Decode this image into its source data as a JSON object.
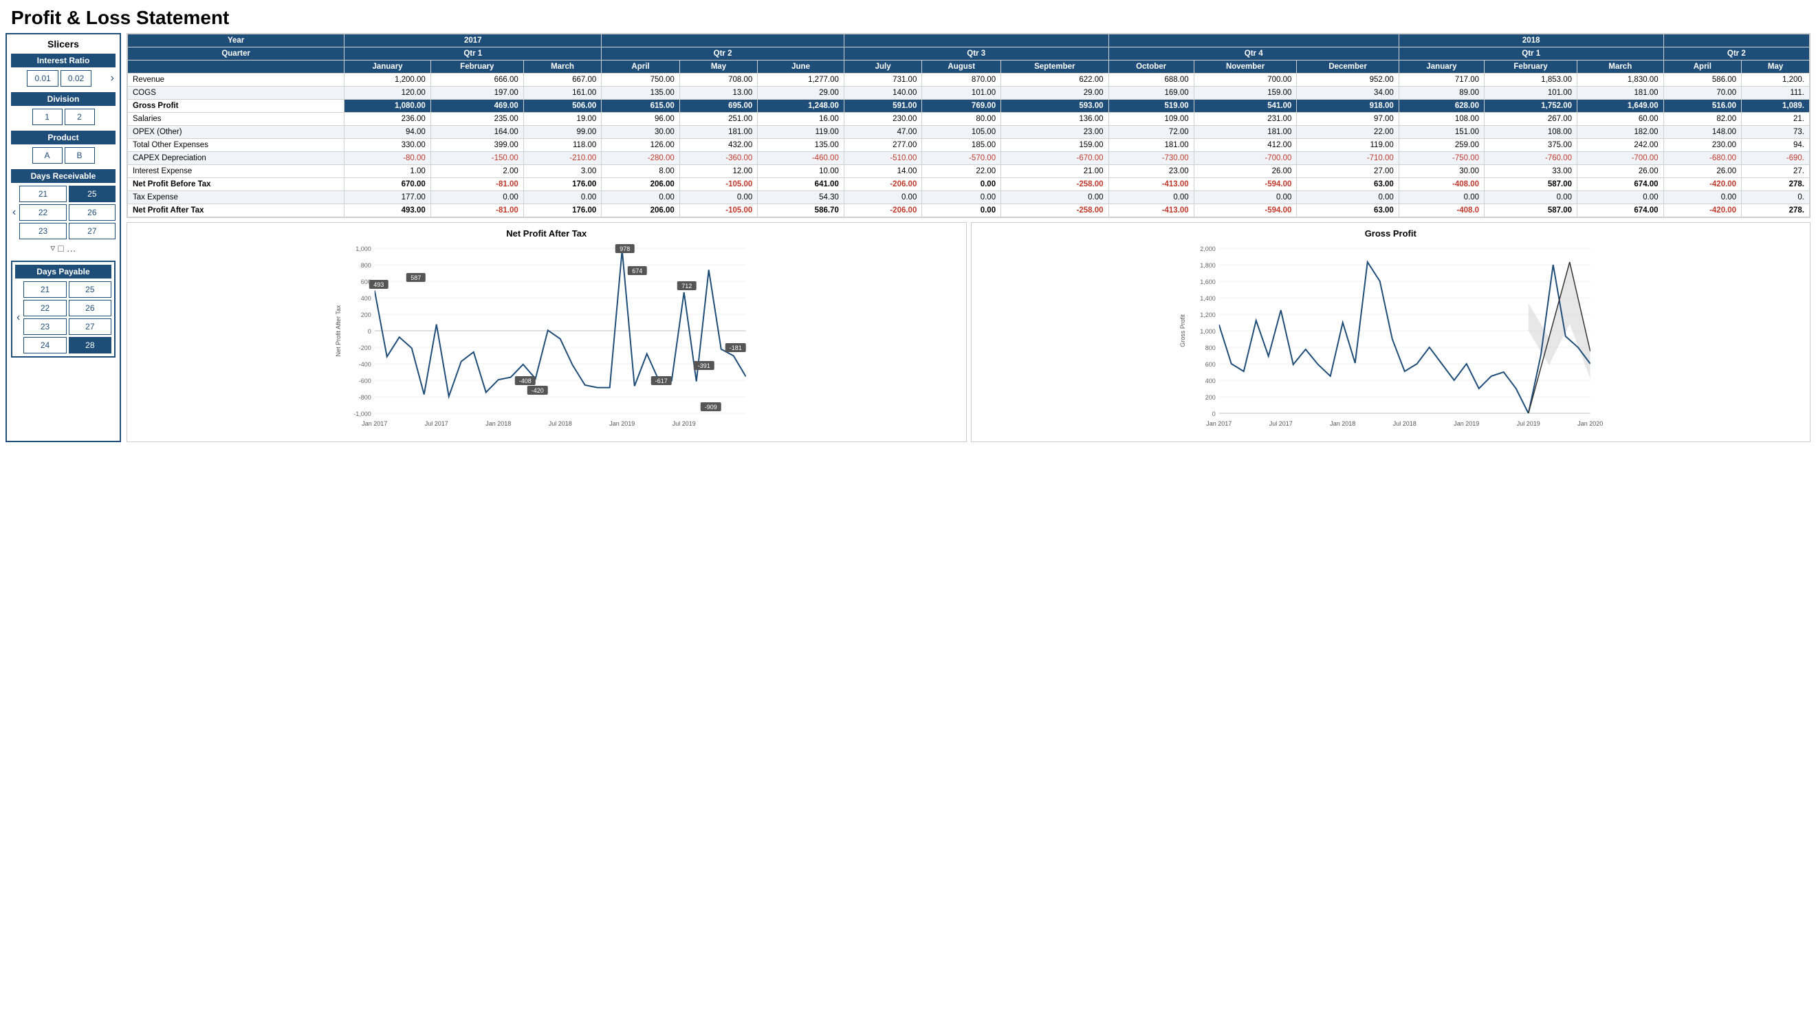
{
  "page": {
    "title": "Profit & Loss Statement"
  },
  "slicers": {
    "title": "Slicers",
    "interest_ratio": {
      "label": "Interest Ratio",
      "items": [
        {
          "value": "0.01",
          "selected": false
        },
        {
          "value": "0.02",
          "selected": false
        }
      ]
    },
    "division": {
      "label": "Division",
      "items": [
        {
          "value": "1",
          "selected": false
        },
        {
          "value": "2",
          "selected": false
        }
      ]
    },
    "product": {
      "label": "Product",
      "items": [
        {
          "value": "A",
          "selected": false
        },
        {
          "value": "B",
          "selected": false
        }
      ]
    },
    "days_receivable": {
      "label": "Days Receivable",
      "rows": [
        [
          {
            "value": "21",
            "selected": false
          },
          {
            "value": "25",
            "selected": true
          }
        ],
        [
          {
            "value": "22",
            "selected": false
          },
          {
            "value": "26",
            "selected": false
          }
        ],
        [
          {
            "value": "23",
            "selected": false
          },
          {
            "value": "27",
            "selected": false
          }
        ]
      ]
    },
    "days_payable": {
      "label": "Days Payable",
      "rows": [
        [
          {
            "value": "21",
            "selected": false
          },
          {
            "value": "25",
            "selected": false
          }
        ],
        [
          {
            "value": "22",
            "selected": false
          },
          {
            "value": "26",
            "selected": false
          }
        ],
        [
          {
            "value": "23",
            "selected": false
          },
          {
            "value": "27",
            "selected": false
          }
        ],
        [
          {
            "value": "24",
            "selected": false
          },
          {
            "value": "28",
            "selected": true
          }
        ]
      ]
    }
  },
  "table": {
    "year_row": [
      "2017",
      "",
      "",
      "",
      "",
      "",
      "",
      "",
      "",
      "",
      "",
      "",
      "",
      "2018",
      "",
      "",
      "",
      ""
    ],
    "quarter_row": [
      "Qtr 1",
      "",
      "",
      "Qtr 2",
      "",
      "",
      "Qtr 3",
      "",
      "",
      "Qtr 4",
      "",
      "",
      "Qtr 1",
      "",
      "",
      "Qtr 2",
      ""
    ],
    "months": [
      "January",
      "February",
      "March",
      "April",
      "May",
      "June",
      "July",
      "August",
      "September",
      "October",
      "November",
      "December",
      "January",
      "February",
      "March",
      "April",
      "May"
    ],
    "rows": [
      {
        "label": "Revenue",
        "bold": false,
        "shaded": false,
        "values": [
          "1,200.00",
          "666.00",
          "667.00",
          "750.00",
          "708.00",
          "1,277.00",
          "731.00",
          "870.00",
          "622.00",
          "688.00",
          "700.00",
          "952.00",
          "717.00",
          "1,853.00",
          "1,830.00",
          "586.00",
          "1,200."
        ]
      },
      {
        "label": "COGS",
        "bold": false,
        "shaded": true,
        "values": [
          "120.00",
          "197.00",
          "161.00",
          "135.00",
          "13.00",
          "29.00",
          "140.00",
          "101.00",
          "29.00",
          "169.00",
          "159.00",
          "34.00",
          "89.00",
          "101.00",
          "181.00",
          "70.00",
          "111."
        ]
      },
      {
        "label": "Gross Profit",
        "bold": true,
        "shaded": false,
        "highlight_row": true,
        "values": [
          "1,080.00",
          "469.00",
          "506.00",
          "615.00",
          "695.00",
          "1,248.00",
          "591.00",
          "769.00",
          "593.00",
          "519.00",
          "541.00",
          "918.00",
          "628.00",
          "1,752.00",
          "1,649.00",
          "516.00",
          "1,089."
        ]
      },
      {
        "label": "Salaries",
        "bold": false,
        "shaded": false,
        "values": [
          "236.00",
          "235.00",
          "19.00",
          "96.00",
          "251.00",
          "16.00",
          "230.00",
          "80.00",
          "136.00",
          "109.00",
          "231.00",
          "97.00",
          "108.00",
          "267.00",
          "60.00",
          "82.00",
          "21."
        ]
      },
      {
        "label": "OPEX (Other)",
        "bold": false,
        "shaded": true,
        "values": [
          "94.00",
          "164.00",
          "99.00",
          "30.00",
          "181.00",
          "119.00",
          "47.00",
          "105.00",
          "23.00",
          "72.00",
          "181.00",
          "22.00",
          "151.00",
          "108.00",
          "182.00",
          "148.00",
          "73."
        ]
      },
      {
        "label": "Total Other Expenses",
        "bold": false,
        "shaded": false,
        "values": [
          "330.00",
          "399.00",
          "118.00",
          "126.00",
          "432.00",
          "135.00",
          "277.00",
          "185.00",
          "159.00",
          "181.00",
          "412.00",
          "119.00",
          "259.00",
          "375.00",
          "242.00",
          "230.00",
          "94."
        ]
      },
      {
        "label": "CAPEX Depreciation",
        "bold": false,
        "shaded": true,
        "negative_all": true,
        "values": [
          "-80.00",
          "-150.00",
          "-210.00",
          "-280.00",
          "-360.00",
          "-460.00",
          "-510.00",
          "-570.00",
          "-670.00",
          "-730.00",
          "-700.00",
          "-710.00",
          "-750.00",
          "-760.00",
          "-700.00",
          "-680.00",
          "-690."
        ]
      },
      {
        "label": "Interest Expense",
        "bold": false,
        "shaded": false,
        "values": [
          "1.00",
          "2.00",
          "3.00",
          "8.00",
          "12.00",
          "10.00",
          "14.00",
          "22.00",
          "21.00",
          "23.00",
          "26.00",
          "27.00",
          "30.00",
          "33.00",
          "26.00",
          "26.00",
          "27."
        ]
      },
      {
        "label": "Net Profit Before Tax",
        "bold": true,
        "shaded": false,
        "values_mixed": [
          {
            "v": "670.00",
            "neg": false
          },
          {
            "v": "-81.00",
            "neg": true
          },
          {
            "v": "176.00",
            "neg": false
          },
          {
            "v": "206.00",
            "neg": false
          },
          {
            "v": "-105.00",
            "neg": true
          },
          {
            "v": "641.00",
            "neg": false
          },
          {
            "v": "-206.00",
            "neg": true
          },
          {
            "v": "0.00",
            "neg": false
          },
          {
            "v": "-258.00",
            "neg": true
          },
          {
            "v": "-413.00",
            "neg": true
          },
          {
            "v": "-594.00",
            "neg": true
          },
          {
            "v": "63.00",
            "neg": false
          },
          {
            "v": "-408.00",
            "neg": true
          },
          {
            "v": "587.00",
            "neg": false
          },
          {
            "v": "674.00",
            "neg": false
          },
          {
            "v": "-420.00",
            "neg": true
          },
          {
            "v": "278.",
            "neg": false
          }
        ]
      },
      {
        "label": "Tax Expense",
        "bold": false,
        "shaded": true,
        "values": [
          "177.00",
          "0.00",
          "0.00",
          "0.00",
          "0.00",
          "54.30",
          "0.00",
          "0.00",
          "0.00",
          "0.00",
          "0.00",
          "0.00",
          "0.00",
          "0.00",
          "0.00",
          "0.00",
          "0."
        ]
      },
      {
        "label": "Net Profit After Tax",
        "bold": true,
        "shaded": false,
        "values_mixed": [
          {
            "v": "493.00",
            "neg": false
          },
          {
            "v": "-81.00",
            "neg": true
          },
          {
            "v": "176.00",
            "neg": false
          },
          {
            "v": "206.00",
            "neg": false
          },
          {
            "v": "-105.00",
            "neg": true
          },
          {
            "v": "586.70",
            "neg": false
          },
          {
            "v": "-206.00",
            "neg": true
          },
          {
            "v": "0.00",
            "neg": false
          },
          {
            "v": "-258.00",
            "neg": true
          },
          {
            "v": "-413.00",
            "neg": true
          },
          {
            "v": "-594.00",
            "neg": true
          },
          {
            "v": "63.00",
            "neg": false
          },
          {
            "v": "-408.0",
            "neg": true
          },
          {
            "v": "587.00",
            "neg": false
          },
          {
            "v": "674.00",
            "neg": false
          },
          {
            "v": "-420.00",
            "neg": true
          },
          {
            "v": "278.",
            "neg": false
          }
        ]
      }
    ]
  },
  "charts": {
    "net_profit": {
      "title": "Net Profit After Tax",
      "y_axis_label": "Net Profit After Tax",
      "y_min": -1000,
      "y_max": 1000,
      "y_ticks": [
        "-1,000",
        "-800",
        "-600",
        "-400",
        "-200",
        "0",
        "200",
        "400",
        "600",
        "800",
        "1,000"
      ],
      "x_labels": [
        "Jan 2017",
        "Jul 2017",
        "Jan 2018",
        "Jul 2018",
        "Jan 2019",
        "Jul 2019"
      ],
      "annotations": [
        {
          "x_pct": 4,
          "y_val": 493,
          "label": "493"
        },
        {
          "x_pct": 15,
          "y_val": 587,
          "label": "587"
        },
        {
          "x_pct": 35,
          "y_val": -408,
          "label": "-408"
        },
        {
          "x_pct": 42,
          "y_val": -420,
          "label": "-420"
        },
        {
          "x_pct": 52,
          "y_val": 978,
          "label": "978"
        },
        {
          "x_pct": 63,
          "y_val": 674,
          "label": "674"
        },
        {
          "x_pct": 67,
          "y_val": -617,
          "label": "-617"
        },
        {
          "x_pct": 71,
          "y_val": 712,
          "label": "712"
        },
        {
          "x_pct": 75,
          "y_val": -909,
          "label": "-909"
        },
        {
          "x_pct": 89,
          "y_val": -181,
          "label": "-181"
        },
        {
          "x_pct": 96,
          "y_val": -391,
          "label": "-391"
        }
      ]
    },
    "gross_profit": {
      "title": "Gross Profit",
      "y_axis_label": "Gross Profit",
      "y_min": 0,
      "y_max": 2000,
      "y_ticks": [
        "0",
        "200",
        "400",
        "600",
        "800",
        "1,000",
        "1,200",
        "1,400",
        "1,600",
        "1,800",
        "2,000"
      ],
      "x_labels": [
        "Jan 2017",
        "Jul 2017",
        "Jan 2018",
        "Jul 2018",
        "Jan 2019",
        "Jul 2019",
        "Jan 2020"
      ]
    }
  }
}
